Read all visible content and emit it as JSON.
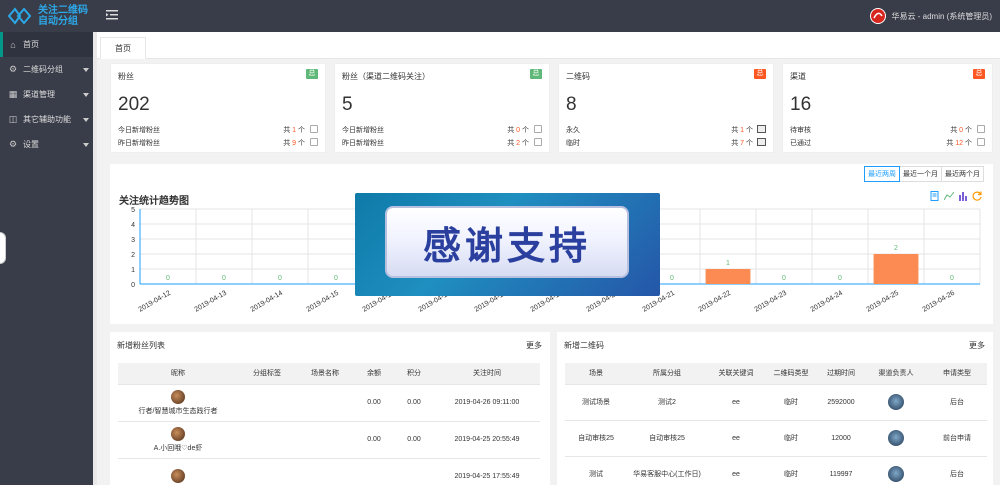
{
  "app": {
    "logo_line1": "关注二维码",
    "logo_line2": "自动分组",
    "user_label": "华易云 - admin (系统管理员)"
  },
  "sidebar": {
    "items": [
      {
        "label": "首页",
        "icon": "home-icon",
        "active": true,
        "has_caret": false
      },
      {
        "label": "二维码分组",
        "icon": "gear-icon",
        "active": false,
        "has_caret": true
      },
      {
        "label": "渠道管理",
        "icon": "grid-icon",
        "active": false,
        "has_caret": true
      },
      {
        "label": "其它辅助功能",
        "icon": "apps-icon",
        "active": false,
        "has_caret": true
      },
      {
        "label": "设置",
        "icon": "settings-icon",
        "active": false,
        "has_caret": true
      }
    ]
  },
  "tabs": [
    {
      "label": "首页"
    }
  ],
  "cards": [
    {
      "title": "粉丝",
      "badge": "总",
      "badge_color": "#5fb878",
      "value": "202",
      "rows": [
        {
          "label": "今日新增粉丝",
          "prefix": "共",
          "num": "1",
          "suffix": "个",
          "icon": "user-icon"
        },
        {
          "label": "昨日新增粉丝",
          "prefix": "共",
          "num": "9",
          "suffix": "个",
          "icon": "user-icon"
        }
      ]
    },
    {
      "title": "粉丝（渠道二维码关注）",
      "badge": "总",
      "badge_color": "#5fb878",
      "value": "5",
      "rows": [
        {
          "label": "今日新增粉丝",
          "prefix": "共",
          "num": "0",
          "suffix": "个",
          "icon": "user-icon"
        },
        {
          "label": "昨日新增粉丝",
          "prefix": "共",
          "num": "2",
          "suffix": "个",
          "icon": "user-icon"
        }
      ]
    },
    {
      "title": "二维码",
      "badge": "总",
      "badge_color": "#ff5722",
      "value": "8",
      "rows": [
        {
          "label": "永久",
          "prefix": "共",
          "num": "1",
          "suffix": "个",
          "icon": "image-icon"
        },
        {
          "label": "临时",
          "prefix": "共",
          "num": "7",
          "suffix": "个",
          "icon": "image-icon"
        }
      ]
    },
    {
      "title": "渠道",
      "badge": "总",
      "badge_color": "#ff5722",
      "value": "16",
      "rows": [
        {
          "label": "待审核",
          "prefix": "共",
          "num": "0",
          "suffix": "个",
          "icon": "calendar-icon"
        },
        {
          "label": "已通过",
          "prefix": "共",
          "num": "12",
          "suffix": "个",
          "icon": "calendar-icon"
        }
      ]
    }
  ],
  "trend": {
    "range_buttons": [
      {
        "label": "最近两周",
        "active": true
      },
      {
        "label": "最近一个月",
        "active": false
      },
      {
        "label": "最近两个月",
        "active": false
      }
    ],
    "title": "关注统计趋势图"
  },
  "chart_data": {
    "type": "bar",
    "title": "关注统计趋势图",
    "categories": [
      "2019-04-12",
      "2019-04-13",
      "2019-04-14",
      "2019-04-15",
      "2019-04-16",
      "2019-04-17",
      "2019-04-18",
      "2019-04-19",
      "2019-04-20",
      "2019-04-21",
      "2019-04-22",
      "2019-04-23",
      "2019-04-24",
      "2019-04-25",
      "2019-04-26"
    ],
    "values": [
      0,
      0,
      0,
      0,
      null,
      null,
      null,
      null,
      null,
      0,
      1,
      0,
      0,
      2,
      0
    ],
    "ylim": [
      0,
      5
    ],
    "yticks": [
      "0",
      "1",
      "2",
      "3",
      "4",
      "5"
    ],
    "bar_color": "#fc8b53",
    "grid": true
  },
  "overlay": {
    "text": "感谢支持"
  },
  "fans_list": {
    "title": "新增粉丝列表",
    "more": "更多",
    "columns": [
      "昵称",
      "分组标签",
      "场景名称",
      "余额",
      "积分",
      "关注时间"
    ],
    "rows": [
      {
        "name": "行者/智慧城市生态践行者",
        "tag": "",
        "scene": "",
        "balance": "0.00",
        "points": "0.00",
        "time": "2019-04-26 09:11:00"
      },
      {
        "name": "A.小回哦♡de虾",
        "tag": "",
        "scene": "",
        "balance": "0.00",
        "points": "0.00",
        "time": "2019-04-25 20:55:49"
      },
      {
        "name": "",
        "tag": "",
        "scene": "",
        "balance": "",
        "points": "",
        "time": "2019-04-25 17:55:49"
      }
    ]
  },
  "qr_list": {
    "title": "新增二维码",
    "more": "更多",
    "columns": [
      "场景",
      "所属分组",
      "关联关键词",
      "二维码类型",
      "过期时间",
      "渠道负责人",
      "申请类型"
    ],
    "rows": [
      {
        "scene": "测试场景",
        "group": "测试2",
        "keyword": "ee",
        "type": "临时",
        "expire": "2592000",
        "owner": "",
        "apply": "后台"
      },
      {
        "scene": "自动审核25",
        "group": "自动审核25",
        "keyword": "ee",
        "type": "临时",
        "expire": "12000",
        "owner": "",
        "apply": "前台申请"
      },
      {
        "scene": "测试",
        "group": "华易客服中心(工作日)",
        "keyword": "ee",
        "type": "临时",
        "expire": "119997",
        "owner": "",
        "apply": "后台"
      }
    ]
  }
}
